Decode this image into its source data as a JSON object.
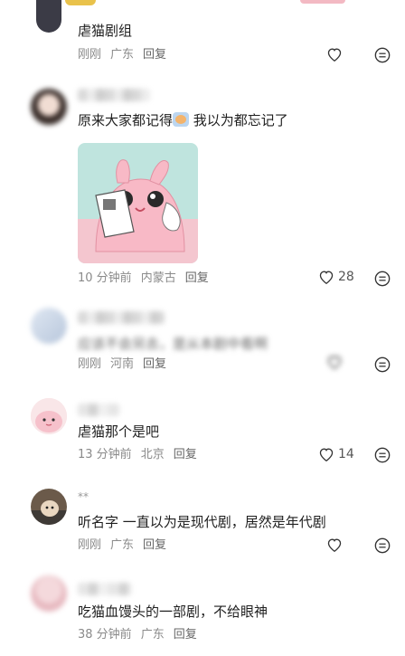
{
  "comments": [
    {
      "text": "虐猫剧组",
      "time": "刚刚",
      "location": "广东",
      "reply": "回复",
      "likes": ""
    },
    {
      "text_before": "原来大家都记得",
      "text_after": " 我以为都忘记了",
      "time": "10 分钟前",
      "location": "内蒙古",
      "reply": "回复",
      "likes": "28"
    },
    {
      "text": "应该不会另去，是从本剧中看啊",
      "time": "刚刚",
      "location": "河南",
      "reply": "回复",
      "likes": ""
    },
    {
      "text": "虐猫那个是吧",
      "time": "13 分钟前",
      "location": "北京",
      "reply": "回复",
      "likes": "14"
    },
    {
      "name": "**",
      "text": "听名字 一直以为是现代剧，居然是年代剧",
      "time": "刚刚",
      "location": "广东",
      "reply": "回复",
      "likes": ""
    },
    {
      "text": "吃猫血馒头的一部剧，不给眼神",
      "time": "38 分钟前",
      "location": "广东",
      "reply": "回复",
      "likes": ""
    }
  ],
  "icons": {
    "like": "heart-outline-icon",
    "more": "more-dots-icon",
    "emoji": "crying-emoji-icon"
  }
}
